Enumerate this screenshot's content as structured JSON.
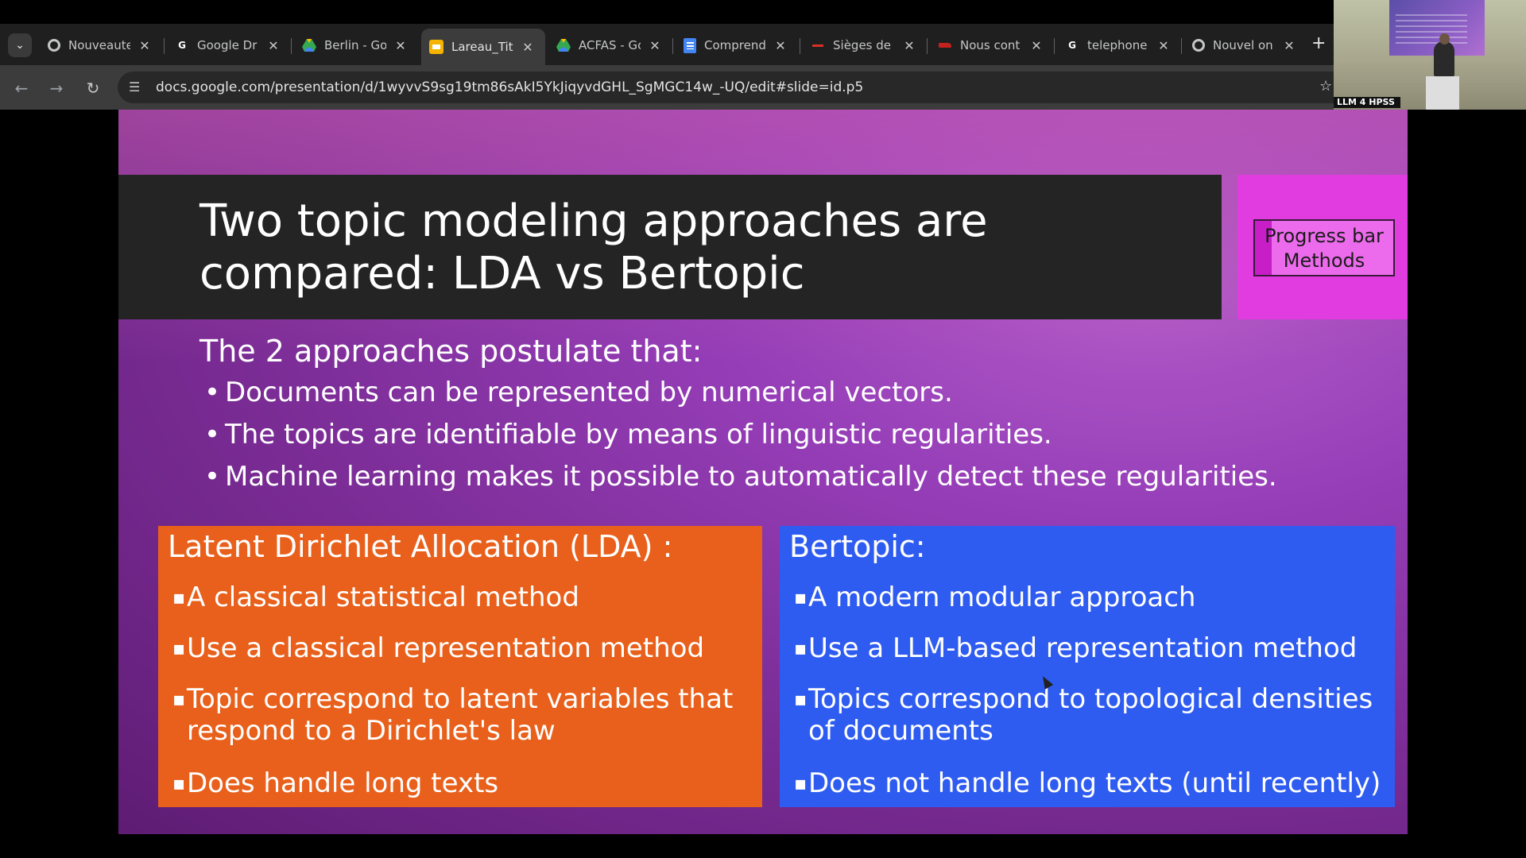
{
  "browser": {
    "tabs": [
      {
        "label": "Nouveaute",
        "favicon": "chrome-icon",
        "active": false
      },
      {
        "label": "Google Dr",
        "favicon": "google-icon",
        "active": false
      },
      {
        "label": "Berlin - Go",
        "favicon": "drive-icon",
        "active": false
      },
      {
        "label": "Lareau_Titl",
        "favicon": "slides-icon",
        "active": true
      },
      {
        "label": "ACFAS - Gc",
        "favicon": "drive-icon",
        "active": false
      },
      {
        "label": "Comprend",
        "favicon": "docs-icon",
        "active": false
      },
      {
        "label": "Sièges de",
        "favicon": "red-dash-icon",
        "active": false
      },
      {
        "label": "Nous cont",
        "favicon": "red-logo-icon",
        "active": false
      },
      {
        "label": "telephone",
        "favicon": "google-icon",
        "active": false
      },
      {
        "label": "Nouvel on",
        "favicon": "chrome-icon",
        "active": false
      }
    ],
    "url": "docs.google.com/presentation/d/1wyvvS9sg19tm86sAkI5YkJiqyvdGHL_SgMGC14w_-UQ/edit#slide=id.p5",
    "new_tab": "+"
  },
  "video": {
    "label": "LLM 4 HPSS"
  },
  "slide": {
    "title": "Two topic modeling approaches are compared: LDA vs Bertopic",
    "progress": {
      "line1": "Progress bar",
      "line2": "Methods",
      "fill_fraction": 0.12
    },
    "intro": "The 2 approaches postulate that:",
    "bullets": [
      "Documents can be represented by numerical vectors.",
      "The topics are identifiable by means of linguistic regularities.",
      "Machine learning makes it possible to automatically detect these regularities."
    ],
    "lda": {
      "title": "Latent Dirichlet Allocation (LDA) :",
      "items": [
        "A classical statistical method",
        "Use a classical representation method",
        "Topic correspond to latent variables that respond to a Dirichlet's law",
        "Does handle long texts"
      ]
    },
    "bertopic": {
      "title": "Bertopic:",
      "items": [
        "A modern modular approach",
        "Use a LLM-based representation method",
        "Topics correspond to topological densities of documents",
        "Does not handle long texts (until recently)"
      ]
    }
  },
  "colors": {
    "lda_card": "#e8601b",
    "bertopic_card": "#2f5cf0",
    "title_box": "#242424",
    "progress_box": "#e03ce0"
  }
}
